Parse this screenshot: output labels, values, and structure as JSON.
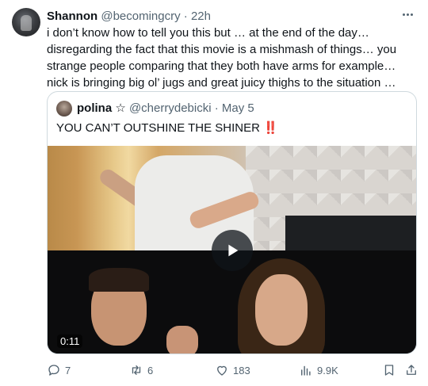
{
  "tweet": {
    "author_name": "Shannon",
    "handle": "@becomingcry",
    "separator": "·",
    "time": "22h",
    "text": "i don’t know how to tell you this but … at the end of the day… disregarding the fact that this movie is a mishmash of things… you strange people comparing that they both have arms for example… nick is bringing big ol’ jugs and great juicy thighs to the situation …",
    "more_icon": "more-horizontal-icon"
  },
  "quote": {
    "author_name": "polina ☆",
    "handle": "@cherrydebicki",
    "separator": "·",
    "time": "May 5",
    "text": "YOU CAN’T OUTSHINE THE SHINER",
    "emoji": "‼️",
    "video_duration": "0:11",
    "play_icon": "play-icon"
  },
  "actions": {
    "replies": "7",
    "retweets": "6",
    "likes": "183",
    "views": "9.9K"
  },
  "colors": {
    "text": "#0f1419",
    "secondary": "#536471",
    "border": "#cfd9de"
  }
}
